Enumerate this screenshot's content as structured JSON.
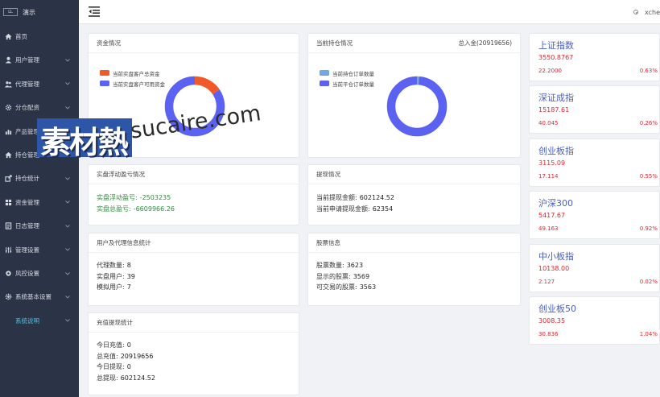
{
  "brand": {
    "logo_text": "LL",
    "name": "演示"
  },
  "sidebar": {
    "items": [
      {
        "label": "首页",
        "icon": "home-icon",
        "expandable": false
      },
      {
        "label": "用户管理",
        "icon": "user-icon",
        "expandable": true
      },
      {
        "label": "代理管理",
        "icon": "agent-icon",
        "expandable": true
      },
      {
        "label": "分仓配资",
        "icon": "gear-icon",
        "expandable": true
      },
      {
        "label": "产品管理",
        "icon": "chart-icon",
        "expandable": true
      },
      {
        "label": "持仓管理",
        "icon": "home-icon",
        "expandable": true
      },
      {
        "label": "持仓统计",
        "icon": "export-icon",
        "expandable": true
      },
      {
        "label": "资金管理",
        "icon": "grid-icon",
        "expandable": true
      },
      {
        "label": "日志管理",
        "icon": "log-icon",
        "expandable": true
      },
      {
        "label": "管理设置",
        "icon": "sliders-icon",
        "expandable": true
      },
      {
        "label": "风控设置",
        "icon": "settings-icon",
        "expandable": true
      },
      {
        "label": "系统基本设置",
        "icon": "cog-icon",
        "expandable": true
      },
      {
        "label": "系统说明",
        "icon": "",
        "expandable": true,
        "active": true
      }
    ]
  },
  "header": {
    "user": "xche"
  },
  "funds_card": {
    "title": "资金情况",
    "legend": [
      {
        "label": "当前实盘客户总资金",
        "color": "#f05a28"
      },
      {
        "label": "当前实盘客户可用资金",
        "color": "#5b62f2"
      }
    ],
    "donut": {
      "segments": [
        {
          "value": 0.155,
          "color": "#f05a28"
        },
        {
          "value": 0.845,
          "color": "#5b62f2"
        }
      ]
    }
  },
  "positions_card": {
    "title": "当前持仓情况",
    "total_label": "总入金(20919656)",
    "legend": [
      {
        "label": "当前持仓订单数量",
        "color": "#73a8e8"
      },
      {
        "label": "当前平仓订单数量",
        "color": "#5b62f2"
      }
    ],
    "donut": {
      "segments": [
        {
          "value": 0.012,
          "color": "#73a8e8"
        },
        {
          "value": 0.988,
          "color": "#5b62f2"
        }
      ]
    }
  },
  "pnl_card": {
    "title": "实盘浮动盈亏情况",
    "rows": [
      {
        "label": "实盘浮动盈亏:",
        "value": "-2503235"
      },
      {
        "label": "实盘总盈亏:",
        "value": "-6609966.26"
      }
    ]
  },
  "withdraw_card": {
    "title": "提现情况",
    "rows": [
      {
        "label": "当前提现金额:",
        "value": "602124.52"
      },
      {
        "label": "当前申请提现金额:",
        "value": "62354"
      }
    ]
  },
  "users_card": {
    "title": "用户及代理信息统计",
    "rows": [
      {
        "label": "代理数量:",
        "value": "8"
      },
      {
        "label": "实盘用户:",
        "value": "39"
      },
      {
        "label": "模拟用户:",
        "value": "7"
      }
    ]
  },
  "stocks_card": {
    "title": "股票信息",
    "rows": [
      {
        "label": "股票数量:",
        "value": "3623"
      },
      {
        "label": "显示的股票:",
        "value": "3569"
      },
      {
        "label": "可交易的股票:",
        "value": "3563"
      }
    ]
  },
  "recharge_card": {
    "title": "充值提现统计",
    "rows": [
      {
        "label": "今日充值:",
        "value": "0"
      },
      {
        "label": "总充值:",
        "value": "20919656"
      },
      {
        "label": "今日提现:",
        "value": "0"
      },
      {
        "label": "总提现:",
        "value": "602124.52"
      }
    ]
  },
  "indices": [
    {
      "name": "上证指数",
      "price": "3550.8767",
      "change": "22.2000",
      "pct": "0.63%"
    },
    {
      "name": "深证成指",
      "price": "15187.61",
      "change": "40.045",
      "pct": "0.26%"
    },
    {
      "name": "创业板指",
      "price": "3115.09",
      "change": "17.114",
      "pct": "0.55%"
    },
    {
      "name": "沪深300",
      "price": "5417.67",
      "change": "49.163",
      "pct": "0.92%"
    },
    {
      "name": "中小板指",
      "price": "10138.00",
      "change": "2.127",
      "pct": "0.02%"
    },
    {
      "name": "创业板50",
      "price": "3008.35",
      "change": "30.836",
      "pct": "1.04%"
    }
  ],
  "watermark": {
    "cjk": "素材熱",
    "latin": "sucaire.com"
  },
  "colors": {
    "sidebar_bg": "#2b3446",
    "accent": "#49c2e8",
    "index_name": "#4a5ec4",
    "up": "#e0262f",
    "pnl": "#2e8b3b"
  }
}
